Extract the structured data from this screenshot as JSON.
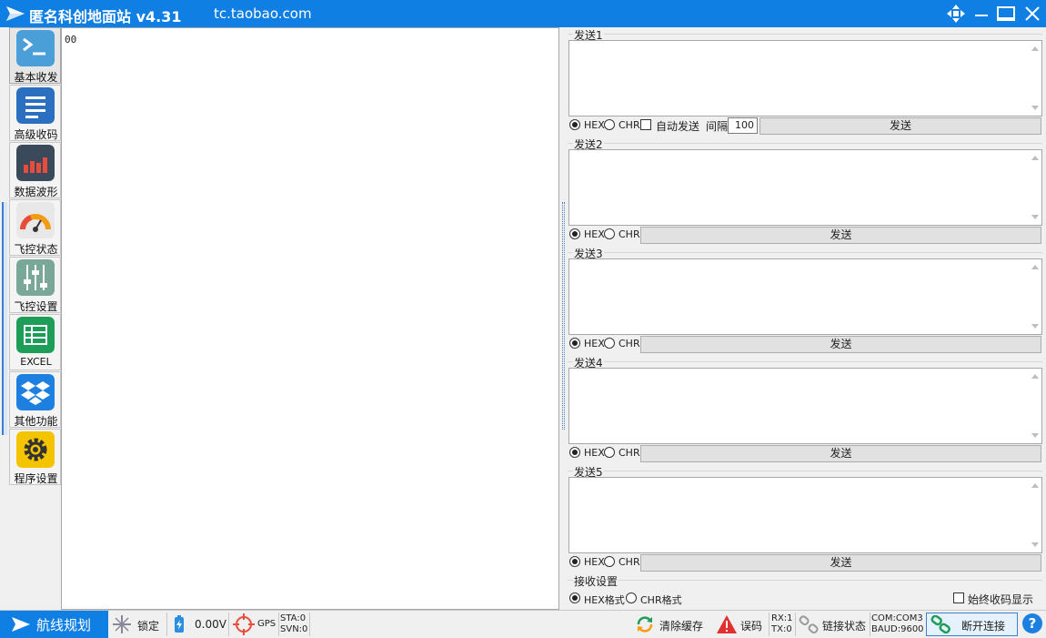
{
  "titlebar": {
    "title": "匿名科创地面站 v4.31",
    "url": "tc.taobao.com"
  },
  "nav": [
    {
      "label": "基本收发",
      "icon": "terminal-icon",
      "color": "#4a9fd8"
    },
    {
      "label": "高级收码",
      "icon": "list-icon",
      "color": "#2a6fc0"
    },
    {
      "label": "数据波形",
      "icon": "bar-chart-icon",
      "color": "#3a4a5a"
    },
    {
      "label": "飞控状态",
      "icon": "gauge-icon",
      "color": "#e8e8e8"
    },
    {
      "label": "飞控设置",
      "icon": "sliders-icon",
      "color": "#7aa898"
    },
    {
      "label": "EXCEL",
      "icon": "spreadsheet-icon",
      "color": "#1e9d58"
    },
    {
      "label": "其他功能",
      "icon": "dropbox-icon",
      "color": "#1d7fe0"
    },
    {
      "label": "程序设置",
      "icon": "gear-icon",
      "color": "#f4c400"
    }
  ],
  "receive": {
    "text": "00"
  },
  "send_groups": [
    {
      "title": "发送1",
      "hex": "HEX",
      "chr": "CHR",
      "auto_send": "自动发送",
      "interval_label": "间隔",
      "interval_value": "100",
      "button": "发送"
    },
    {
      "title": "发送2",
      "hex": "HEX",
      "chr": "CHR",
      "button": "发送"
    },
    {
      "title": "发送3",
      "hex": "HEX",
      "chr": "CHR",
      "button": "发送"
    },
    {
      "title": "发送4",
      "hex": "HEX",
      "chr": "CHR",
      "button": "发送"
    },
    {
      "title": "发送5",
      "hex": "HEX",
      "chr": "CHR",
      "button": "发送"
    }
  ],
  "receive_settings": {
    "title": "接收设置",
    "hex_format": "HEX格式",
    "chr_format": "CHR格式",
    "always_show": "始终收码显示"
  },
  "status": {
    "route": "航线规划",
    "lock": "锁定",
    "voltage": "0.00V",
    "gps": "GPS",
    "sta": "STA:0",
    "svn": "SVN:0",
    "clear": "清除缓存",
    "error": "误码",
    "rx": "RX:1",
    "tx": "TX:0",
    "link_state": "链接状态",
    "com": "COM:COM3",
    "baud": "BAUD:9600",
    "disconnect": "断开连接",
    "help": "?"
  },
  "colors": {
    "accent": "#0f7fe4"
  }
}
